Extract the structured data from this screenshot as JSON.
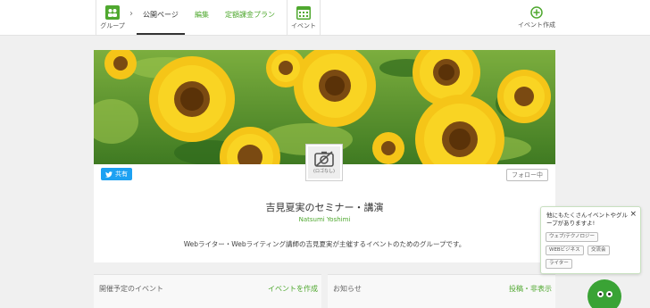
{
  "nav": {
    "group_label": "グループ",
    "arrow": "›",
    "tabs": [
      {
        "label": "公開ページ",
        "active": true
      },
      {
        "label": "編集",
        "active": false
      },
      {
        "label": "定額課金プラン",
        "active": false
      }
    ],
    "event_label": "イベント",
    "create_event_label": "イベント作成"
  },
  "colors": {
    "accent": "#4fa82f",
    "twitter": "#1da1f2",
    "mascot": "#3aa335"
  },
  "card": {
    "share_label": "共有",
    "follow_label": "フォロー中",
    "no_logo_label": "(ロゴなし)",
    "title": "吉見夏実のセミナー・講演",
    "subtitle": "Natsumi Yoshimi",
    "description": "Webライター・Webライティング講師の吉見夏実が主催するイベントのためのグループです。"
  },
  "sections": {
    "upcoming_title": "開催予定のイベント",
    "create_event_link": "イベントを作成",
    "news_title": "お知らせ",
    "news_link": "投稿・非表示"
  },
  "popup": {
    "text": "他にもたくさんイベントやグループがありますよ!",
    "close": "×",
    "tags": [
      "ウェブ/テクノロジー",
      "WEBビジネス",
      "交流会",
      "ライター"
    ]
  }
}
